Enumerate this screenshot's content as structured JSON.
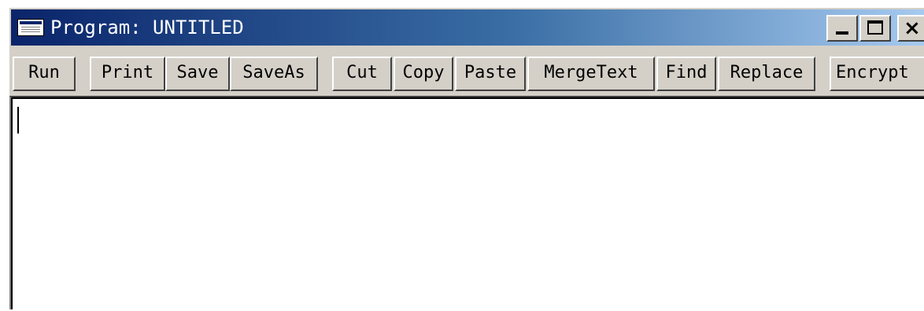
{
  "window": {
    "title": "Program: UNTITLED",
    "controls": {
      "minimize": "minimize",
      "maximize": "maximize",
      "close": "×"
    }
  },
  "toolbar": {
    "buttons": [
      {
        "label": "Run"
      },
      {
        "label": "Print"
      },
      {
        "label": "Save"
      },
      {
        "label": "SaveAs"
      },
      {
        "label": "Cut"
      },
      {
        "label": "Copy"
      },
      {
        "label": "Paste"
      },
      {
        "label": "MergeText"
      },
      {
        "label": "Find"
      },
      {
        "label": "Replace"
      },
      {
        "label": "Encrypt"
      }
    ]
  },
  "editor": {
    "content": ""
  },
  "icons": {
    "app": "notepad-window-icon",
    "minimize": "minimize-icon",
    "maximize": "maximize-icon",
    "close": "close-icon"
  }
}
